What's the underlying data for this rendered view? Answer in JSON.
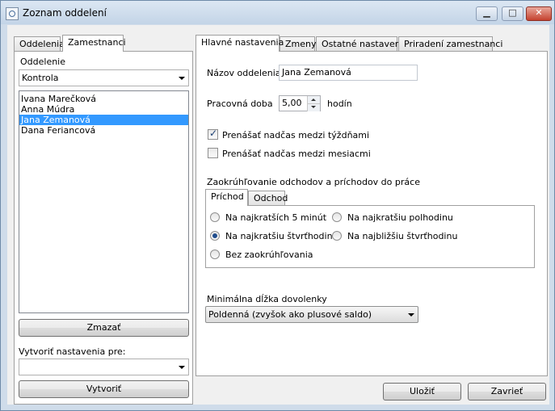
{
  "window": {
    "title": "Zoznam oddelení"
  },
  "left_tabs": [
    "Oddelenia",
    "Zamestnanci"
  ],
  "left": {
    "department_label": "Oddelenie",
    "department_value": "Kontrola",
    "employees": [
      "Ivana Marečková",
      "Anna Múdra",
      "Jana Zemanová",
      "Dana Feriancová"
    ],
    "selected_index": 2,
    "delete_label": "Zmazať",
    "create_for_label": "Vytvoriť nastavenia pre:",
    "create_for_value": "",
    "create_label": "Vytvoriť"
  },
  "right_tabs": [
    "Hlavné nastavenia",
    "Zmeny",
    "Ostatné nastavenia",
    "Priradení zamestnanci"
  ],
  "settings": {
    "name_label": "Názov oddelenia",
    "name_value": "Jana Zemanová",
    "work_time_label": "Pracovná doba",
    "work_time_value": "5,00",
    "work_time_unit": "hodín",
    "transfer_week_label": "Prenášať nadčas medzi týždňami",
    "transfer_week_checked": true,
    "transfer_month_label": "Prenášať nadčas medzi mesiacmi",
    "transfer_month_checked": false,
    "rounding_label": "Zaokrúhľovanie odchodov a príchodov do práce",
    "rounding_tabs": [
      "Príchod",
      "Odchod"
    ],
    "rounding_options": [
      "Na najkratších 5 minút",
      "Na najkratšiu polhodinu",
      "Na najkratšiu štvrťhodinu",
      "Na najbližšiu štvrťhodinu",
      "Bez zaokrúhľovania"
    ],
    "rounding_selected": "Na najkratšiu štvrťhodinu",
    "vacation_label": "Minimálna dĺžka dovolenky",
    "vacation_value": "Poldenná (zvyšok ako plusové saldo)"
  },
  "footer": {
    "save_label": "Uložiť",
    "close_label": "Zavrieť"
  }
}
